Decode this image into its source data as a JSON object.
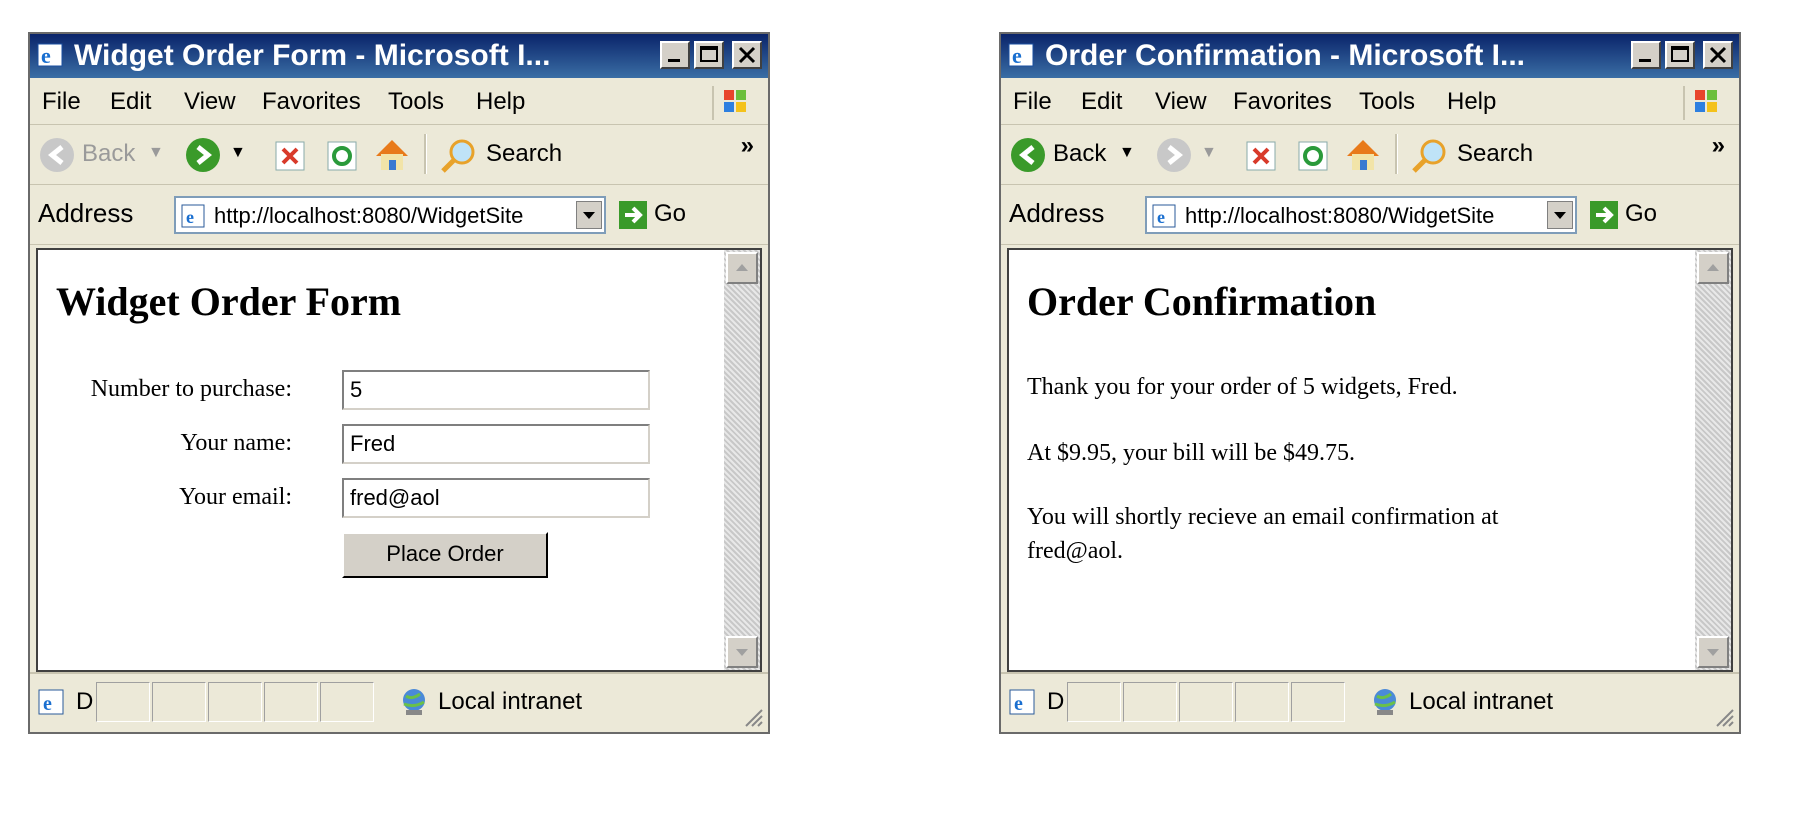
{
  "windows": [
    {
      "title": "Widget Order Form - Microsoft I...",
      "menu": [
        "File",
        "Edit",
        "View",
        "Favorites",
        "Tools",
        "Help"
      ],
      "toolbar": {
        "back": "Back",
        "search": "Search",
        "more": "»"
      },
      "address": {
        "label": "Address",
        "url": "http://localhost:8080/WidgetSite",
        "go": "Go"
      },
      "page": {
        "heading": "Widget Order Form",
        "fields": [
          {
            "label": "Number to purchase:",
            "value": "5"
          },
          {
            "label": "Your name:",
            "value": "Fred"
          },
          {
            "label": "Your email:",
            "value": "fred@aol"
          }
        ],
        "submit": "Place Order"
      },
      "status": {
        "text": "D",
        "zone": "Local intranet"
      }
    },
    {
      "title": "Order Confirmation - Microsoft I...",
      "menu": [
        "File",
        "Edit",
        "View",
        "Favorites",
        "Tools",
        "Help"
      ],
      "toolbar": {
        "back": "Back",
        "search": "Search",
        "more": "»"
      },
      "address": {
        "label": "Address",
        "url": "http://localhost:8080/WidgetSite",
        "go": "Go"
      },
      "page": {
        "heading": "Order Confirmation",
        "paragraphs": [
          "Thank you for your order of 5 widgets, Fred.",
          "At $9.95, your bill will be $49.75.",
          "You will shortly recieve an email confirmation at fred@aol."
        ]
      },
      "status": {
        "text": "D",
        "zone": "Local intranet"
      }
    }
  ],
  "colors": {
    "titlebar": "#0a246a",
    "chrome": "#ece9d8",
    "go_green": "#3a9a2a"
  }
}
